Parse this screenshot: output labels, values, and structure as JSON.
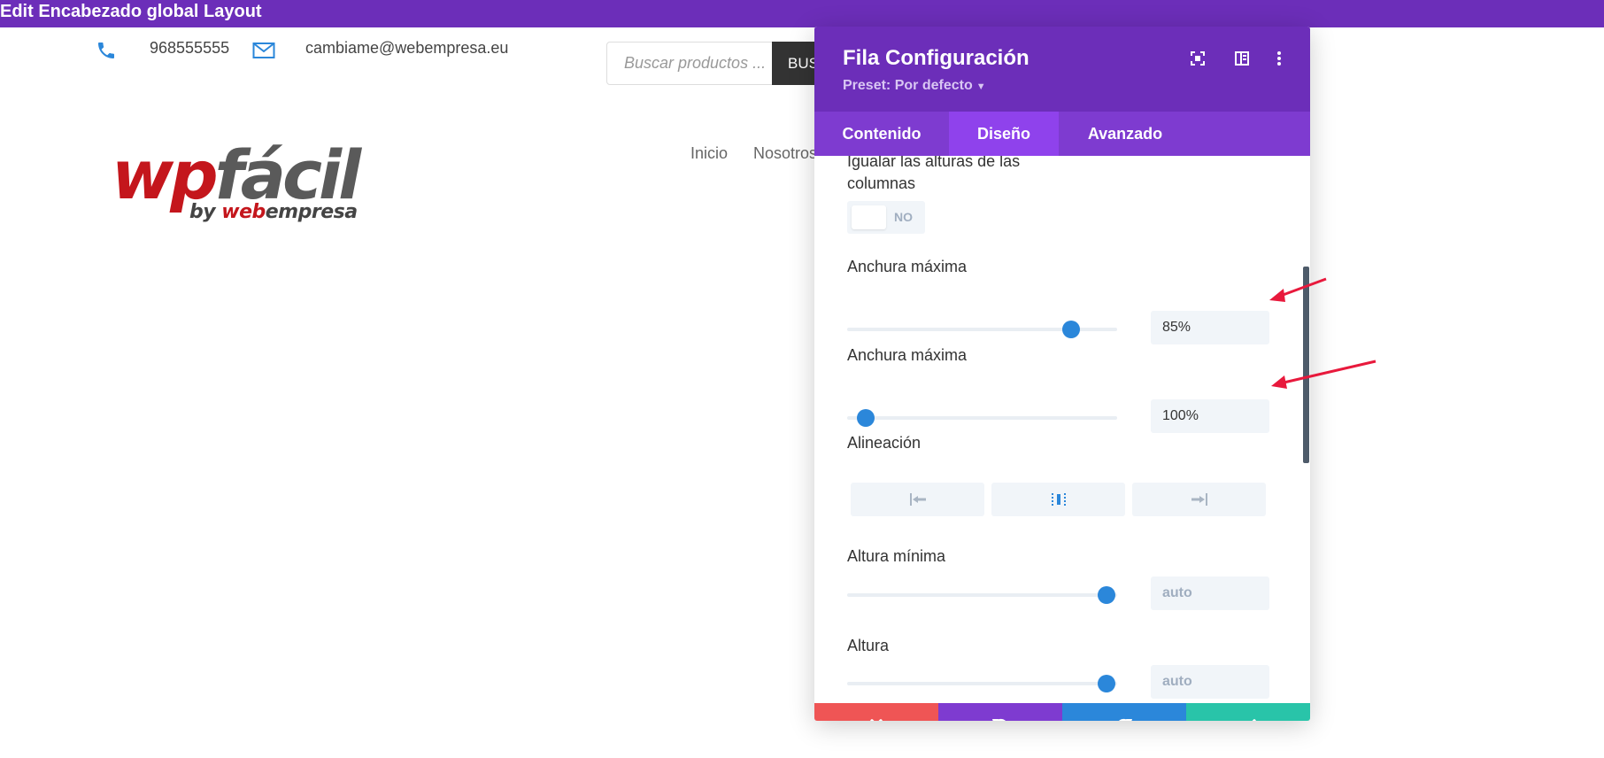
{
  "topbar": {
    "title": "Edit Encabezado global Layout"
  },
  "header": {
    "phone": "968555555",
    "email": "cambiame@webempresa.eu",
    "search_placeholder": "Buscar productos ...",
    "search_button": "BUSCAR",
    "icons": {
      "phone": "phone-icon",
      "mail": "envelope-icon"
    }
  },
  "logo": {
    "wp": "wp",
    "facil": "fácil",
    "by": "by ",
    "web": "web",
    "empresa": "empresa"
  },
  "nav": {
    "items": [
      "Inicio",
      "Nosotros"
    ]
  },
  "modal": {
    "title": "Fila Configuración",
    "preset": "Preset: Por defecto",
    "tabs": [
      {
        "label": "Contenido",
        "active": false
      },
      {
        "label": "Diseño",
        "active": true
      },
      {
        "label": "Avanzado",
        "active": false
      }
    ],
    "fields": {
      "equal_heights": {
        "label_line1": "Igualar las alturas de las",
        "label_line2": "columnas",
        "toggle_text": "NO"
      },
      "max_width_1": {
        "label": "Anchura máxima",
        "value": "85%",
        "slider_position": 0.83
      },
      "max_width_2": {
        "label": "Anchura máxima",
        "value": "100%",
        "slider_position": 0.07
      },
      "alignment": {
        "label": "Alineación",
        "options": [
          "align-left-icon",
          "align-center-icon",
          "align-right-icon"
        ]
      },
      "min_height": {
        "label": "Altura mínima",
        "value": "auto",
        "slider_position": 0.96
      },
      "height": {
        "label": "Altura",
        "value": "auto",
        "slider_position": 0.96
      }
    },
    "footer": [
      "close-icon",
      "undo-icon",
      "redo-icon",
      "check-icon"
    ]
  },
  "colors": {
    "brand_purple": "#6c2eb9",
    "tab_active": "#8f42ec",
    "slider_blue": "#2b87da",
    "btn_red": "#ef5555",
    "btn_purple": "#7e3bd0",
    "btn_blue": "#2b87da",
    "btn_green": "#29c4a9",
    "annotation_red": "#e8193c"
  }
}
